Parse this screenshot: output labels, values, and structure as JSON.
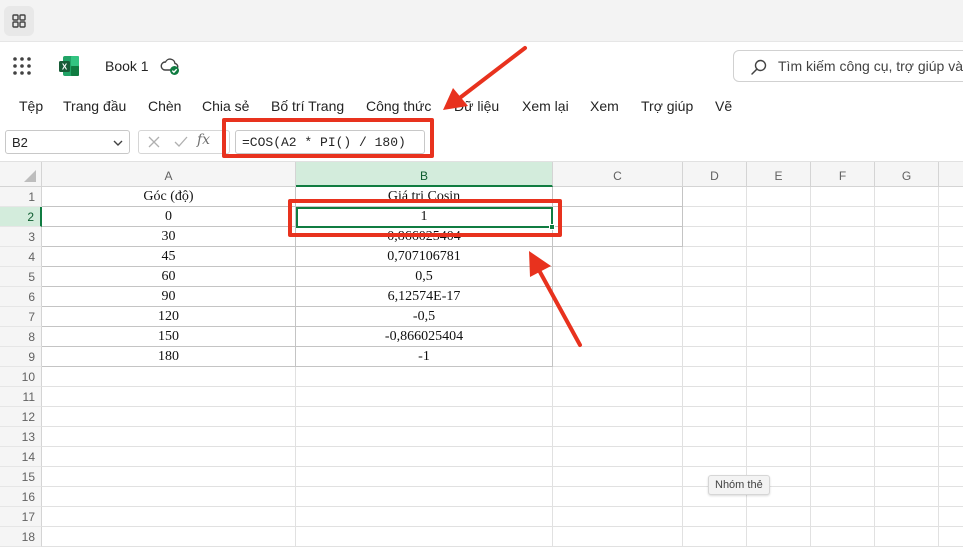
{
  "window": {
    "apps_icon": "grid-icon"
  },
  "header": {
    "waffle_icon": "waffle-icon",
    "app_logo": "excel-logo",
    "book_title": "Book 1",
    "sync_icon": "cloud-check-icon",
    "search": {
      "placeholder": "Tìm kiếm công cụ, trợ giúp và"
    }
  },
  "ribbon": {
    "tabs": [
      "Tệp",
      "Trang đầu",
      "Chèn",
      "Chia sẻ",
      "Bố trí Trang",
      "Công thức",
      "Dữ liệu",
      "Xem lại",
      "Xem",
      "Trợ giúp",
      "Vẽ"
    ]
  },
  "formula_bar": {
    "name_box": "B2",
    "fx_label": "fx",
    "formula": "=COS(A2 * PI() / 180)"
  },
  "grid": {
    "columns": [
      "A",
      "B",
      "C",
      "D",
      "E",
      "F",
      "G"
    ],
    "selected_column": "B",
    "rows": [
      "1",
      "2",
      "3",
      "4",
      "5",
      "6",
      "7",
      "8",
      "9",
      "10",
      "11",
      "12",
      "13",
      "14",
      "15",
      "16",
      "17",
      "18"
    ],
    "selected_row": "2",
    "cells": [
      [
        "Góc (độ)",
        "Giá trị Cosin"
      ],
      [
        "0",
        "1"
      ],
      [
        "30",
        "0,866025404"
      ],
      [
        "45",
        "0,707106781"
      ],
      [
        "60",
        "0,5"
      ],
      [
        "90",
        "6,12574E-17"
      ],
      [
        "120",
        "-0,5"
      ],
      [
        "150",
        "-0,866025404"
      ],
      [
        "180",
        "-1"
      ]
    ]
  },
  "tooltip": "Nhóm thẻ",
  "colors": {
    "accent": "#107c41",
    "annotation": "#e8321e"
  }
}
